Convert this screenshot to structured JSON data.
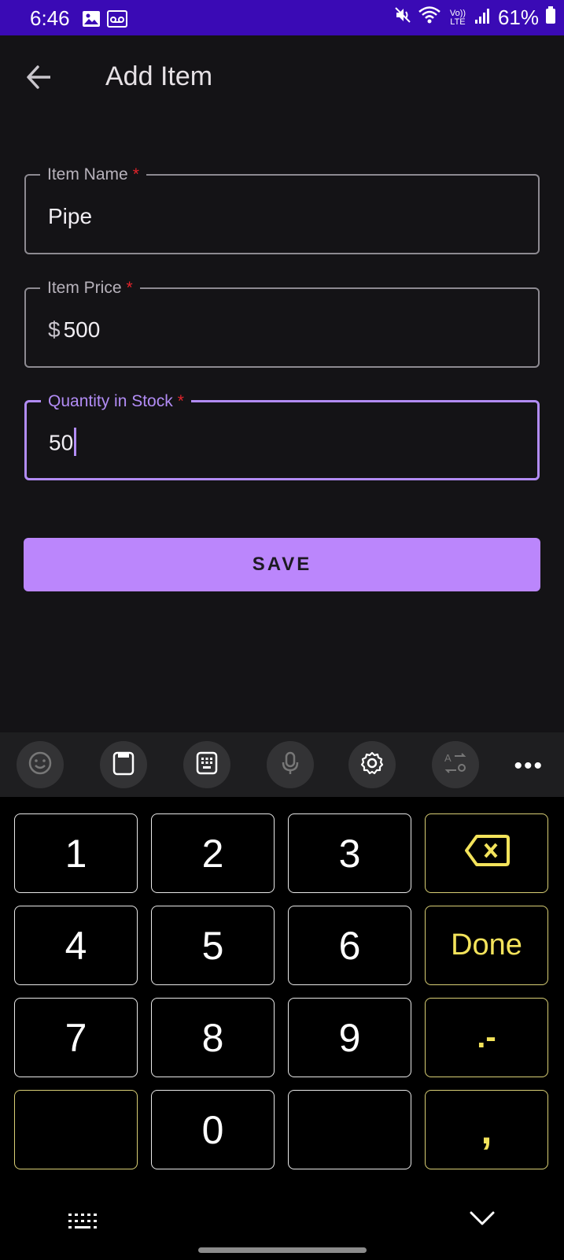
{
  "status_bar": {
    "time": "6:46",
    "battery": "61%",
    "network_label": "Vo)) LTE",
    "icons": [
      "gallery-icon",
      "voicemail-icon",
      "mute-icon",
      "wifi-icon",
      "signal-icon",
      "battery-icon"
    ]
  },
  "app_bar": {
    "title": "Add Item",
    "back_icon": "arrow-back-icon"
  },
  "form": {
    "item_name": {
      "label": "Item Name",
      "required_mark": "*",
      "value": "Pipe"
    },
    "item_price": {
      "label": "Item Price",
      "required_mark": "*",
      "prefix": "$",
      "value": "500"
    },
    "quantity": {
      "label": "Quantity in Stock",
      "required_mark": "*",
      "value": "50",
      "focused": true
    },
    "save_label": "SAVE"
  },
  "keyboard_toolbar": {
    "buttons": [
      "emoji-icon",
      "clipboard-icon",
      "keypad-icon",
      "microphone-icon",
      "settings-icon",
      "translate-icon"
    ],
    "more": "•••"
  },
  "keypad": {
    "keys": [
      "1",
      "2",
      "3",
      "backspace",
      "4",
      "5",
      "6",
      "Done",
      "7",
      "8",
      "9",
      ".-",
      "",
      "0",
      "",
      ","
    ],
    "done_label": "Done",
    "dot_minus_label": ".-",
    "comma_label": ","
  },
  "colors": {
    "status_bar": "#3a0ab5",
    "background": "#141316",
    "accent": "#bb86fc",
    "focus_border": "#b28cf5",
    "required": "#e3242b",
    "keyboard_accent": "#f3e35b"
  }
}
